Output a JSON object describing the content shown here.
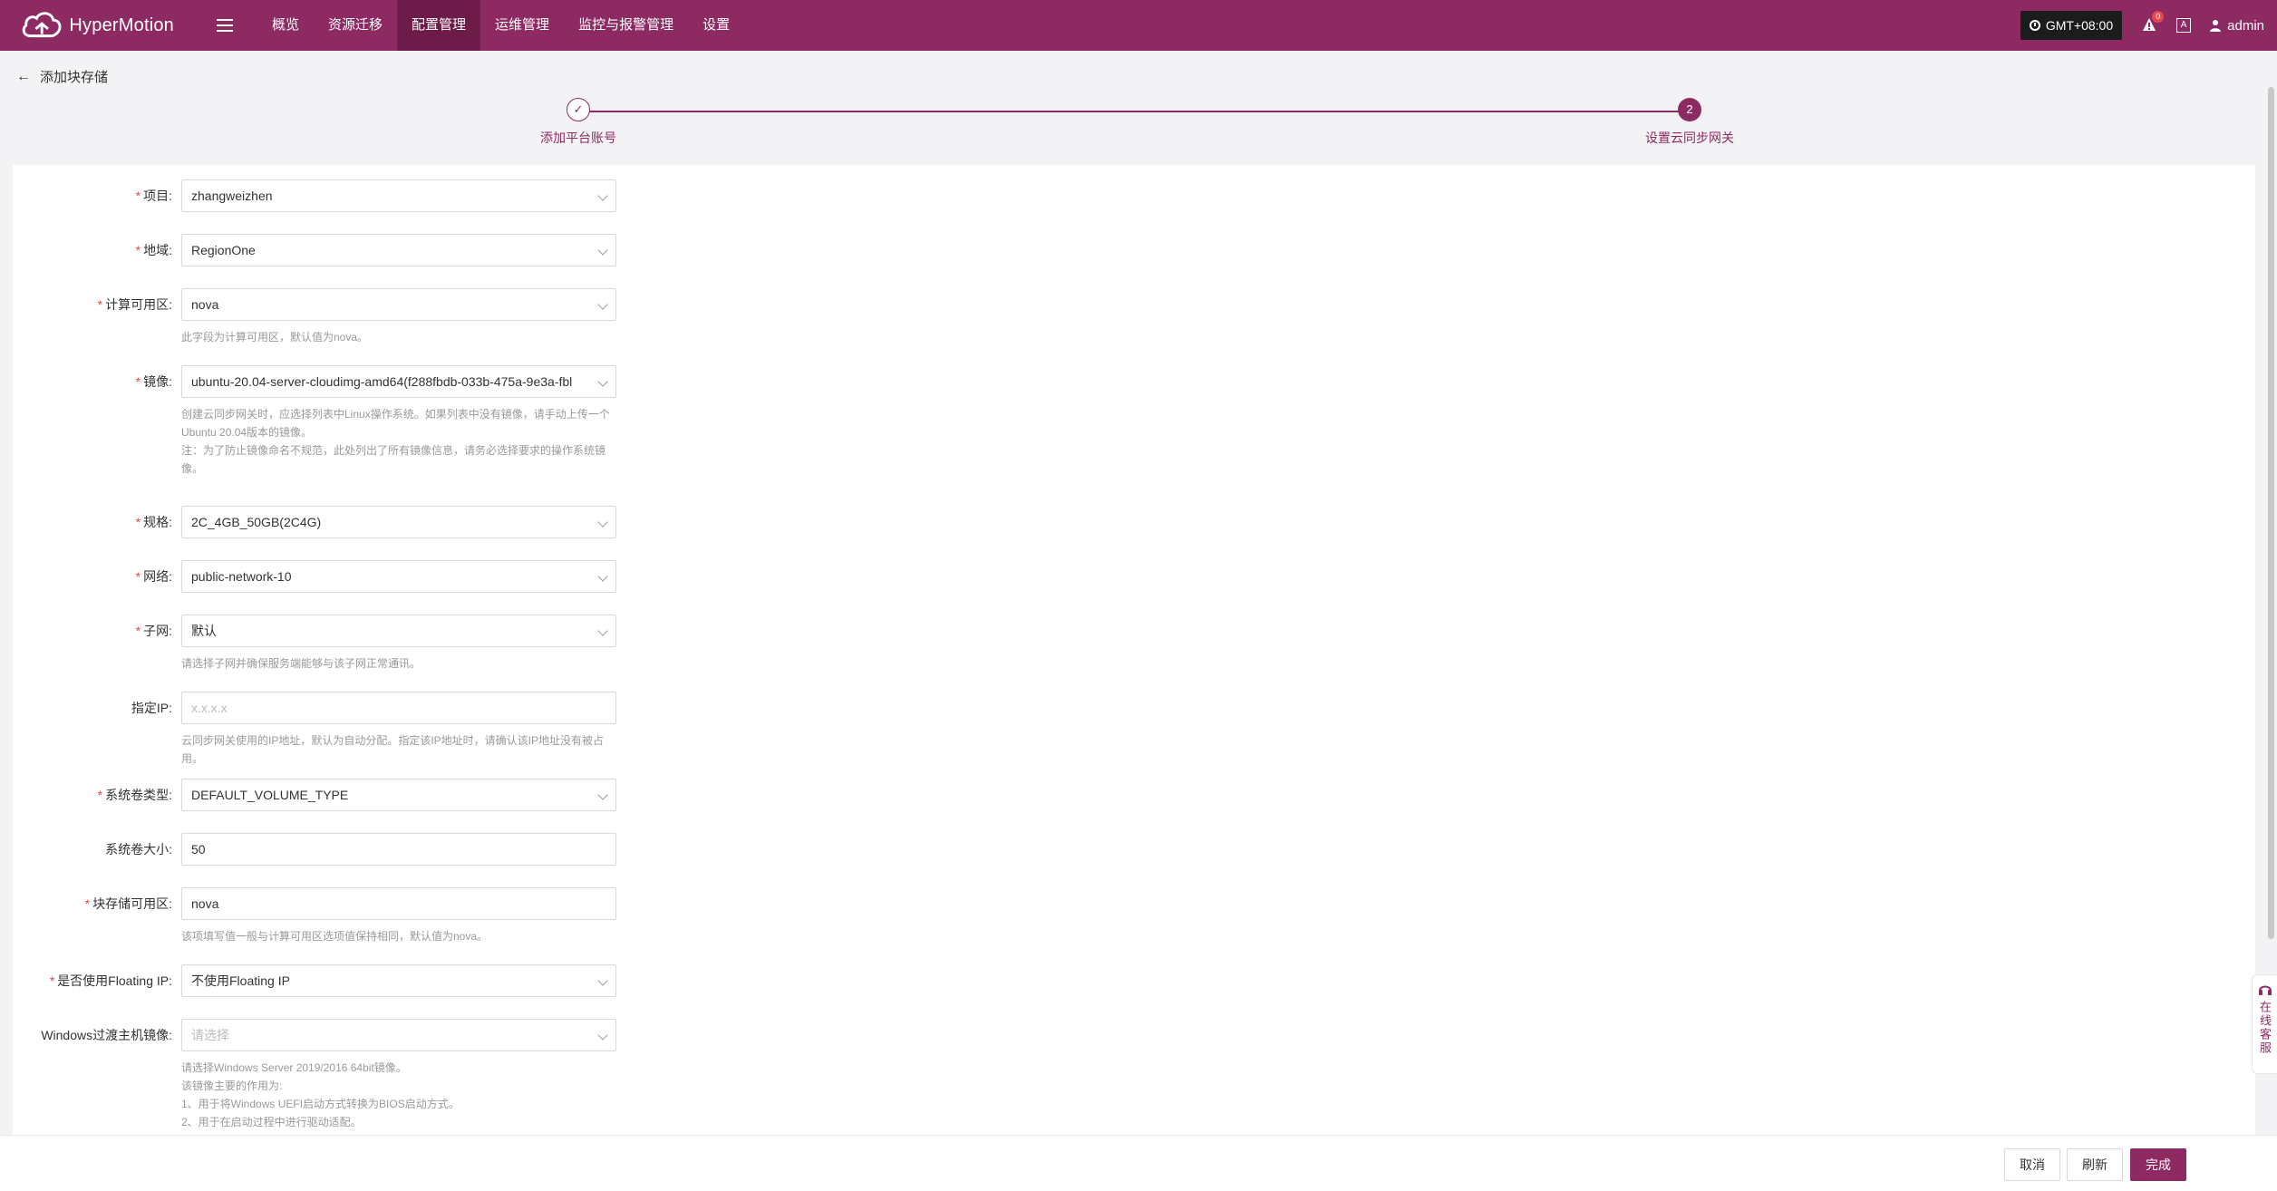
{
  "app": {
    "brand": "HyperMotion",
    "accent": "#8e2a62"
  },
  "nav": {
    "items": [
      {
        "label": "概览",
        "active": false
      },
      {
        "label": "资源迁移",
        "active": false
      },
      {
        "label": "配置管理",
        "active": true
      },
      {
        "label": "运维管理",
        "active": false
      },
      {
        "label": "监控与报警管理",
        "active": false
      },
      {
        "label": "设置",
        "active": false
      }
    ]
  },
  "topright": {
    "timezone": "GMT+08:00",
    "bell_badge": "0",
    "lang_icon": "A",
    "user": "admin"
  },
  "page": {
    "back_label": "添加块存储"
  },
  "steps": [
    {
      "label": "添加平台账号",
      "state": "done",
      "marker": "✓"
    },
    {
      "label": "设置云同步网关",
      "state": "current",
      "marker": "2"
    }
  ],
  "form": {
    "project": {
      "label": "项目:",
      "value": "zhangweizhen"
    },
    "region": {
      "label": "地域:",
      "value": "RegionOne"
    },
    "az": {
      "label": "计算可用区:",
      "value": "nova",
      "hint": "此字段为计算可用区，默认值为nova。"
    },
    "image": {
      "label": "镜像:",
      "value": "ubuntu-20.04-server-cloudimg-amd64(f288fbdb-033b-475a-9e3a-fbl",
      "hint1": "创建云同步网关时，应选择列表中Linux操作系统。如果列表中没有镜像，请手动上传一个Ubuntu 20.04版本的镜像。",
      "hint2": "注：为了防止镜像命名不规范，此处列出了所有镜像信息，请务必选择要求的操作系统镜像。"
    },
    "flavor": {
      "label": "规格:",
      "value": "2C_4GB_50GB(2C4G)"
    },
    "network": {
      "label": "网络:",
      "value": "public-network-10"
    },
    "subnet": {
      "label": "子网:",
      "value": "默认",
      "hint": "请选择子网并确保服务端能够与该子网正常通讯。"
    },
    "ip": {
      "label": "指定IP:",
      "placeholder": "x.x.x.x",
      "hint": "云同步网关使用的IP地址，默认为自动分配。指定该IP地址时，请确认该IP地址没有被占用。"
    },
    "vol_type": {
      "label": "系统卷类型:",
      "value": "DEFAULT_VOLUME_TYPE"
    },
    "vol_size": {
      "label": "系统卷大小:",
      "value": "50"
    },
    "block_az": {
      "label": "块存储可用区:",
      "value": "nova",
      "hint": "该项填写值一般与计算可用区选项值保持相同，默认值为nova。"
    },
    "floating": {
      "label": "是否使用Floating IP:",
      "value": "不使用Floating IP"
    },
    "win_image": {
      "label": "Windows过渡主机镜像:",
      "placeholder": "请选择",
      "hint1": "请选择Windows Server 2019/2016 64bit镜像。",
      "hint2": "该镜像主要的作用为:",
      "hint3": "1、用于将Windows UEFI启动方式转换为BIOS启动方式。",
      "hint4": "2、用于在启动过程中进行驱动适配。"
    }
  },
  "footer": {
    "cancel": "取消",
    "refresh": "刷新",
    "finish": "完成"
  },
  "service": {
    "label": "在线客服"
  }
}
